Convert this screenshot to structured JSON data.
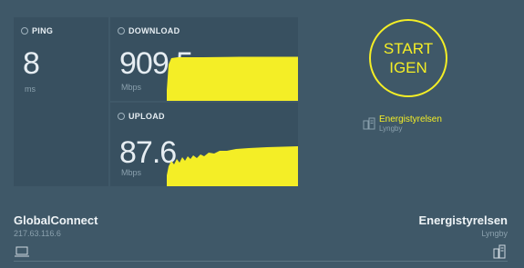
{
  "ping": {
    "label": "PING",
    "value": "8",
    "unit": "ms"
  },
  "download": {
    "label": "DOWNLOAD",
    "value": "909.5",
    "unit": "Mbps"
  },
  "upload": {
    "label": "UPLOAD",
    "value": "87.6",
    "unit": "Mbps"
  },
  "start_button": {
    "line1": "START",
    "line2": "IGEN"
  },
  "server": {
    "name": "Energistyrelsen",
    "location": "Lyngby"
  },
  "isp": {
    "name": "GlobalConnect",
    "ip": "217.63.116.6"
  },
  "colors": {
    "background": "#3f5868",
    "panel": "#385060",
    "accent": "#f4ee26"
  },
  "icons": [
    "ping-icon",
    "download-icon",
    "upload-icon",
    "server-icon",
    "laptop-icon"
  ]
}
